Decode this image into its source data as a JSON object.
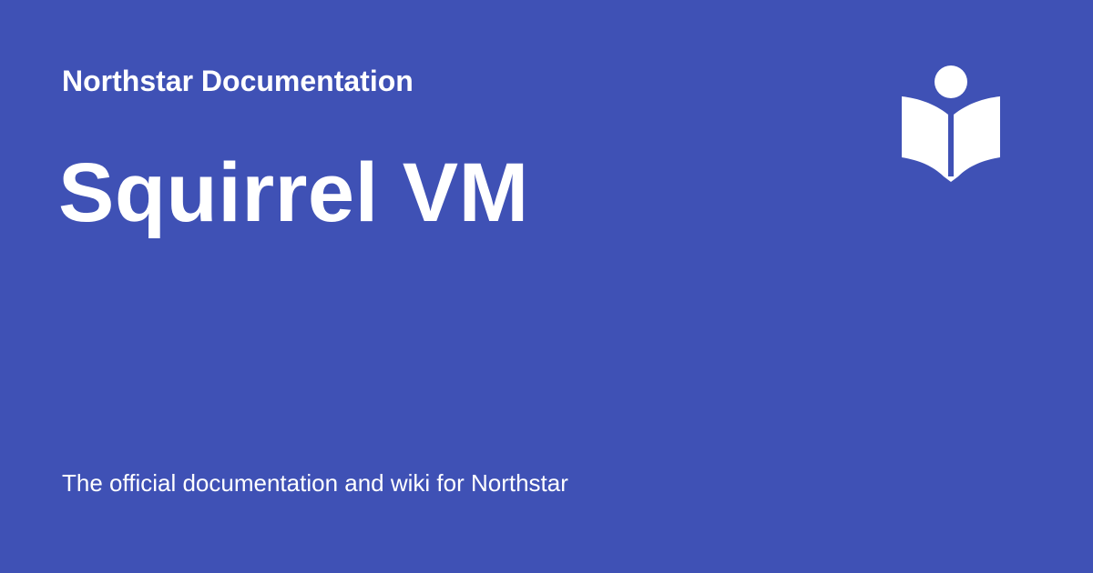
{
  "site": {
    "name": "Northstar Documentation",
    "logo_icon": "book-reader-icon"
  },
  "page": {
    "title": "Squirrel VM",
    "description": "The official documentation and wiki for Northstar"
  },
  "colors": {
    "background": "#3f51b5",
    "text": "#ffffff"
  }
}
